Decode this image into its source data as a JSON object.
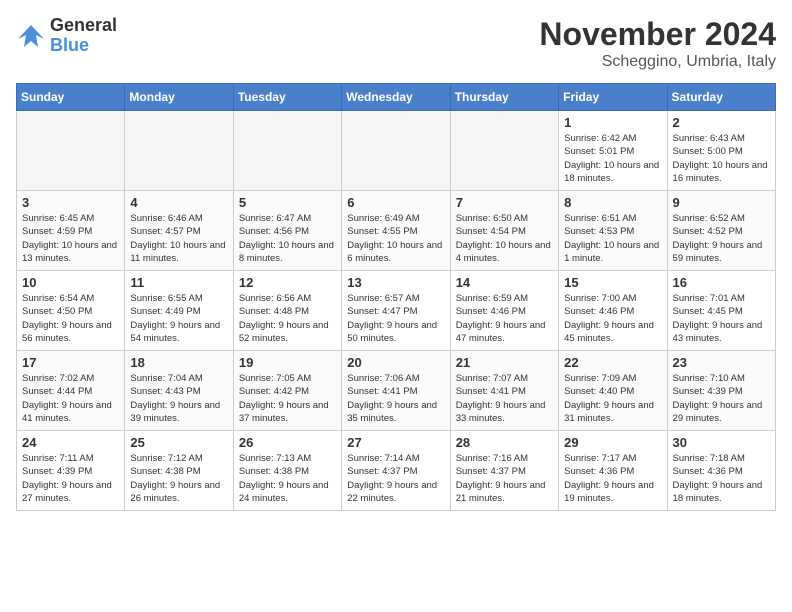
{
  "logo": {
    "text_general": "General",
    "text_blue": "Blue"
  },
  "title": "November 2024",
  "location": "Scheggino, Umbria, Italy",
  "days_of_week": [
    "Sunday",
    "Monday",
    "Tuesday",
    "Wednesday",
    "Thursday",
    "Friday",
    "Saturday"
  ],
  "weeks": [
    [
      {
        "day": "",
        "empty": true
      },
      {
        "day": "",
        "empty": true
      },
      {
        "day": "",
        "empty": true
      },
      {
        "day": "",
        "empty": true
      },
      {
        "day": "",
        "empty": true
      },
      {
        "day": "1",
        "sunrise": "6:42 AM",
        "sunset": "5:01 PM",
        "daylight": "10 hours and 18 minutes."
      },
      {
        "day": "2",
        "sunrise": "6:43 AM",
        "sunset": "5:00 PM",
        "daylight": "10 hours and 16 minutes."
      }
    ],
    [
      {
        "day": "3",
        "sunrise": "6:45 AM",
        "sunset": "4:59 PM",
        "daylight": "10 hours and 13 minutes."
      },
      {
        "day": "4",
        "sunrise": "6:46 AM",
        "sunset": "4:57 PM",
        "daylight": "10 hours and 11 minutes."
      },
      {
        "day": "5",
        "sunrise": "6:47 AM",
        "sunset": "4:56 PM",
        "daylight": "10 hours and 8 minutes."
      },
      {
        "day": "6",
        "sunrise": "6:49 AM",
        "sunset": "4:55 PM",
        "daylight": "10 hours and 6 minutes."
      },
      {
        "day": "7",
        "sunrise": "6:50 AM",
        "sunset": "4:54 PM",
        "daylight": "10 hours and 4 minutes."
      },
      {
        "day": "8",
        "sunrise": "6:51 AM",
        "sunset": "4:53 PM",
        "daylight": "10 hours and 1 minute."
      },
      {
        "day": "9",
        "sunrise": "6:52 AM",
        "sunset": "4:52 PM",
        "daylight": "9 hours and 59 minutes."
      }
    ],
    [
      {
        "day": "10",
        "sunrise": "6:54 AM",
        "sunset": "4:50 PM",
        "daylight": "9 hours and 56 minutes."
      },
      {
        "day": "11",
        "sunrise": "6:55 AM",
        "sunset": "4:49 PM",
        "daylight": "9 hours and 54 minutes."
      },
      {
        "day": "12",
        "sunrise": "6:56 AM",
        "sunset": "4:48 PM",
        "daylight": "9 hours and 52 minutes."
      },
      {
        "day": "13",
        "sunrise": "6:57 AM",
        "sunset": "4:47 PM",
        "daylight": "9 hours and 50 minutes."
      },
      {
        "day": "14",
        "sunrise": "6:59 AM",
        "sunset": "4:46 PM",
        "daylight": "9 hours and 47 minutes."
      },
      {
        "day": "15",
        "sunrise": "7:00 AM",
        "sunset": "4:46 PM",
        "daylight": "9 hours and 45 minutes."
      },
      {
        "day": "16",
        "sunrise": "7:01 AM",
        "sunset": "4:45 PM",
        "daylight": "9 hours and 43 minutes."
      }
    ],
    [
      {
        "day": "17",
        "sunrise": "7:02 AM",
        "sunset": "4:44 PM",
        "daylight": "9 hours and 41 minutes."
      },
      {
        "day": "18",
        "sunrise": "7:04 AM",
        "sunset": "4:43 PM",
        "daylight": "9 hours and 39 minutes."
      },
      {
        "day": "19",
        "sunrise": "7:05 AM",
        "sunset": "4:42 PM",
        "daylight": "9 hours and 37 minutes."
      },
      {
        "day": "20",
        "sunrise": "7:06 AM",
        "sunset": "4:41 PM",
        "daylight": "9 hours and 35 minutes."
      },
      {
        "day": "21",
        "sunrise": "7:07 AM",
        "sunset": "4:41 PM",
        "daylight": "9 hours and 33 minutes."
      },
      {
        "day": "22",
        "sunrise": "7:09 AM",
        "sunset": "4:40 PM",
        "daylight": "9 hours and 31 minutes."
      },
      {
        "day": "23",
        "sunrise": "7:10 AM",
        "sunset": "4:39 PM",
        "daylight": "9 hours and 29 minutes."
      }
    ],
    [
      {
        "day": "24",
        "sunrise": "7:11 AM",
        "sunset": "4:39 PM",
        "daylight": "9 hours and 27 minutes."
      },
      {
        "day": "25",
        "sunrise": "7:12 AM",
        "sunset": "4:38 PM",
        "daylight": "9 hours and 26 minutes."
      },
      {
        "day": "26",
        "sunrise": "7:13 AM",
        "sunset": "4:38 PM",
        "daylight": "9 hours and 24 minutes."
      },
      {
        "day": "27",
        "sunrise": "7:14 AM",
        "sunset": "4:37 PM",
        "daylight": "9 hours and 22 minutes."
      },
      {
        "day": "28",
        "sunrise": "7:16 AM",
        "sunset": "4:37 PM",
        "daylight": "9 hours and 21 minutes."
      },
      {
        "day": "29",
        "sunrise": "7:17 AM",
        "sunset": "4:36 PM",
        "daylight": "9 hours and 19 minutes."
      },
      {
        "day": "30",
        "sunrise": "7:18 AM",
        "sunset": "4:36 PM",
        "daylight": "9 hours and 18 minutes."
      }
    ]
  ]
}
